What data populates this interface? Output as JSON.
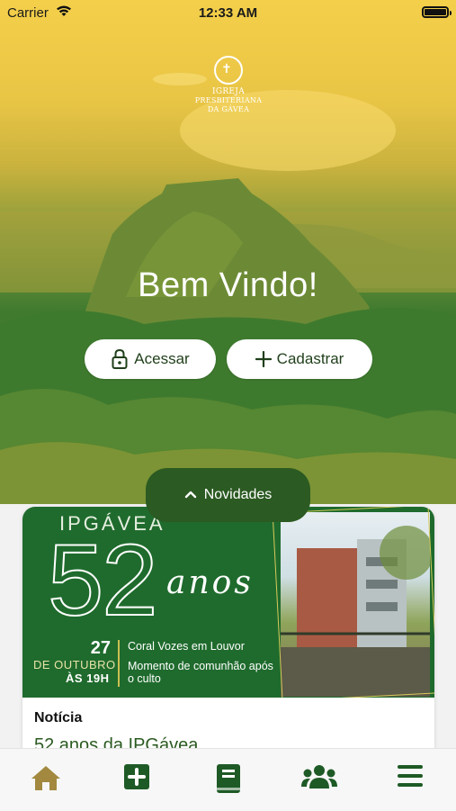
{
  "status_bar": {
    "carrier": "Carrier",
    "time": "12:33 AM"
  },
  "logo": {
    "line1": "IGREJA",
    "line2": "PRESBITERIANA",
    "line3": "DA GÁVEA"
  },
  "hero": {
    "welcome": "Bem Vindo!"
  },
  "actions": {
    "access_label": "Acessar",
    "signup_label": "Cadastrar"
  },
  "news_panel": {
    "tab_label": "Novidades"
  },
  "news_card": {
    "banner": {
      "brand": "IPGÁVEA",
      "number": "52",
      "word": "anos",
      "day": "27",
      "month": "DE OUTUBRO",
      "hour": "ÀS 19H",
      "event1": "Coral Vozes em Louvor",
      "event2": "Momento de comunhão após o culto"
    },
    "category": "Notícia",
    "title": "52 anos da IPGávea"
  },
  "tabbar": {
    "items": [
      "home-icon",
      "plus-square-icon",
      "book-icon",
      "users-icon",
      "menu-icon"
    ]
  },
  "colors": {
    "brand_green": "#2b5a22",
    "tab_icon_active": "#a2893f",
    "tab_icon": "#1e5a26"
  }
}
